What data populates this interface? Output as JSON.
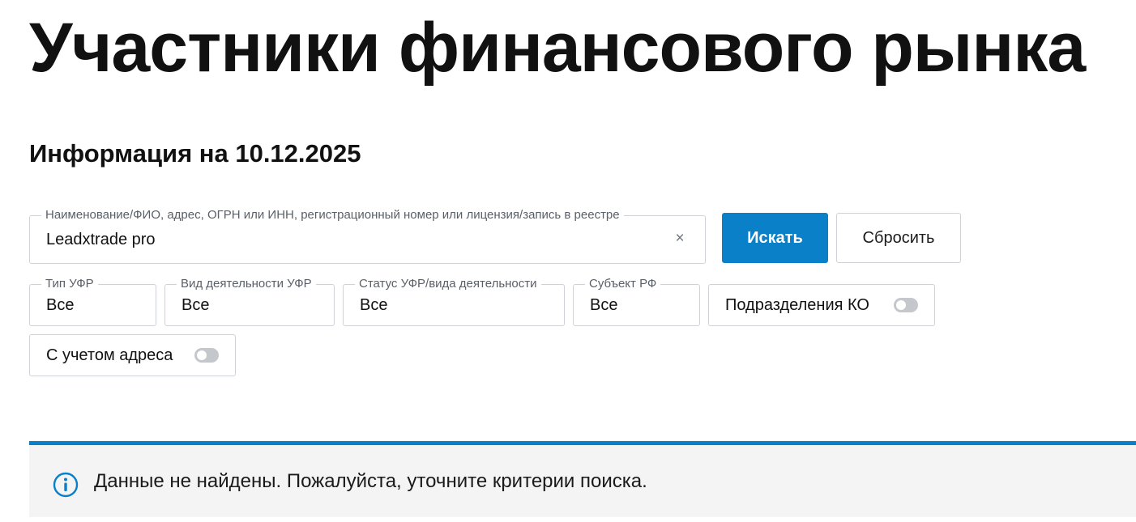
{
  "page": {
    "title": "Участники финансового рынка",
    "subtitle": "Информация на 10.12.2025"
  },
  "search": {
    "legend": "Наименование/ФИО, адрес, ОГРН или ИНН, регистрационный номер или лицензия/запись в реестре",
    "value": "Leadxtrade pro",
    "clear_icon": "×",
    "search_button": "Искать",
    "reset_button": "Сбросить"
  },
  "filters": [
    {
      "legend": "Тип УФР",
      "value": "Все"
    },
    {
      "legend": "Вид деятельности УФР",
      "value": "Все"
    },
    {
      "legend": "Статус УФР/вида деятельности",
      "value": "Все"
    },
    {
      "legend": "Субъект РФ",
      "value": "Все"
    }
  ],
  "toggles": [
    {
      "label": "Подразделения КО",
      "enabled": false
    },
    {
      "label": "С учетом адреса",
      "enabled": false
    }
  ],
  "result": {
    "icon": "info-icon",
    "message": "Данные не найдены. Пожалуйста, уточните критерии поиска."
  },
  "colors": {
    "accent": "#0a80c8",
    "border": "#cfd2d6",
    "panel_background": "#f4f4f4",
    "toggle_off": "#c4c8cc"
  }
}
